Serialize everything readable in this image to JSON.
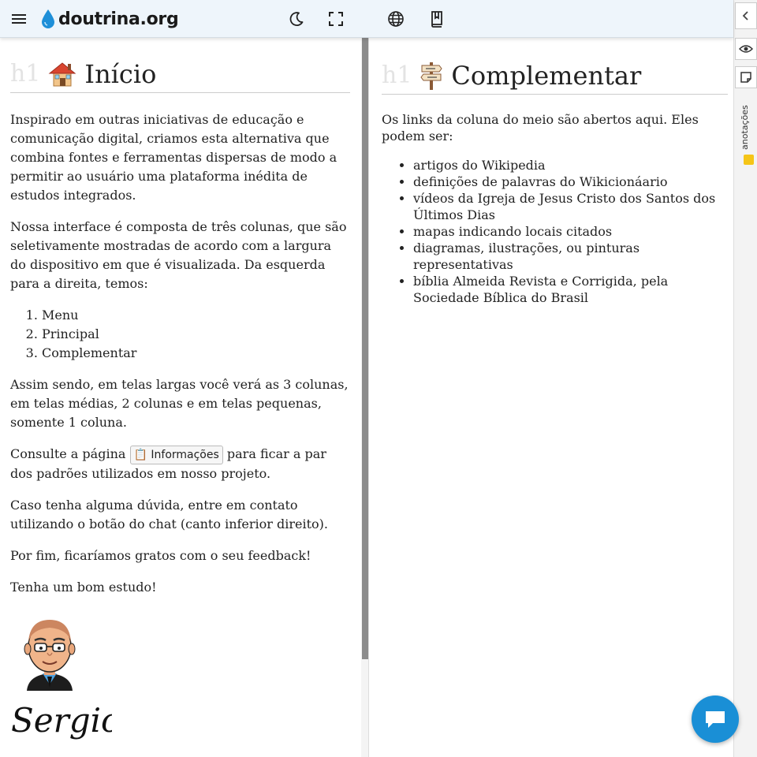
{
  "header": {
    "brand": "doutrina.org",
    "icons": [
      "menu-icon",
      "drop-icon",
      "dark-mode-icon",
      "fullscreen-icon",
      "globe-icon",
      "book-icon"
    ],
    "brand_color": "#1e8fd8"
  },
  "rail": {
    "label": "anotações",
    "icons": [
      "collapse-chevron-icon",
      "eye-icon",
      "note-icon"
    ],
    "chip_color": "#f5c518"
  },
  "main": {
    "heading_tag": "h1",
    "title": "Início",
    "title_icon": "house-icon",
    "paragraphs": [
      "Inspirado em outras iniciativas de educação e comunicação digital, criamos esta alternativa que combina fontes e ferramentas dispersas de modo a permitir ao usuário uma plataforma inédita de estudos integrados.",
      "Nossa interface é composta de três colunas, que são seletivamente mostradas de acordo com a largura do dispositivo em que é visualizada. Da esquerda para a direita, temos:"
    ],
    "columns_list": [
      "Menu",
      "Principal",
      "Complementar"
    ],
    "after_list": "Assim sendo, em telas largas você verá as 3 colunas, em telas médias, 2 colunas e em telas pequenas, somente 1 coluna.",
    "consult_before": "Consulte a página",
    "consult_button": "Informações",
    "consult_after": "para ficar a par dos padrões utilizados em nosso projeto.",
    "contact": "Caso tenha alguma dúvida, entre em contato utilizando o botão do chat (canto inferior direito).",
    "feedback": "Por fim, ficaríamos gratos com o seu feedback!",
    "farewell": "Tenha um bom estudo!",
    "signature": "Sergio"
  },
  "complementar": {
    "heading_tag": "h1",
    "title": "Complementar",
    "title_icon": "signpost-icon",
    "intro": "Os links da coluna do meio são abertos aqui. Eles podem ser:",
    "items": [
      "artigos do Wikipedia",
      "definições de palavras do Wikicionáario",
      "vídeos da Igreja de Jesus Cristo dos Santos dos Últimos Dias",
      "mapas indicando locais citados",
      "diagramas, ilustrações, ou pinturas representativas",
      "bíblia Almeida Revista e Corrigida, pela Sociedade Bíblica do Brasil"
    ]
  },
  "chat": {
    "icon": "chat-icon",
    "color": "#1a8fd6"
  }
}
